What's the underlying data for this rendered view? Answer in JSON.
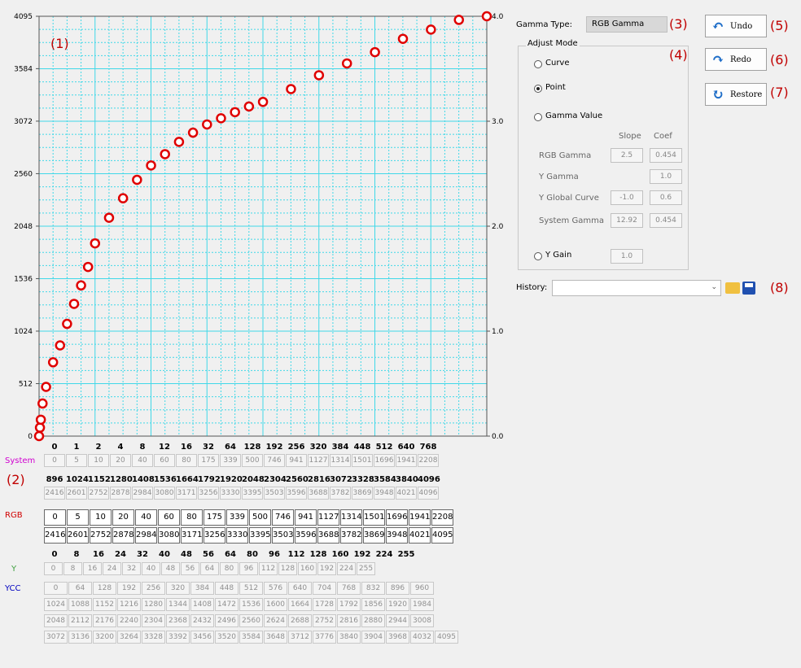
{
  "chart_data": {
    "type": "scatter",
    "y_axis_left": {
      "ticks": [
        "4095",
        "3584",
        "3072",
        "2560",
        "2048",
        "1536",
        "1024",
        "512",
        "0"
      ],
      "range": [
        0,
        4095
      ]
    },
    "y_axis_right": {
      "ticks": [
        "4.0",
        "3.0",
        "2.0",
        "1.0",
        "0.0"
      ],
      "range": [
        0,
        4
      ]
    },
    "x_range": [
      0,
      4095
    ],
    "points": [
      {
        "x": 0,
        "y": 0
      },
      {
        "x": 8,
        "y": 83
      },
      {
        "x": 16,
        "y": 160
      },
      {
        "x": 32,
        "y": 318
      },
      {
        "x": 64,
        "y": 480
      },
      {
        "x": 128,
        "y": 720
      },
      {
        "x": 192,
        "y": 885
      },
      {
        "x": 256,
        "y": 1095
      },
      {
        "x": 320,
        "y": 1290
      },
      {
        "x": 384,
        "y": 1470
      },
      {
        "x": 448,
        "y": 1650
      },
      {
        "x": 512,
        "y": 1880
      },
      {
        "x": 640,
        "y": 2130
      },
      {
        "x": 768,
        "y": 2320
      },
      {
        "x": 896,
        "y": 2500
      },
      {
        "x": 1024,
        "y": 2640
      },
      {
        "x": 1152,
        "y": 2750
      },
      {
        "x": 1280,
        "y": 2870
      },
      {
        "x": 1408,
        "y": 2960
      },
      {
        "x": 1536,
        "y": 3040
      },
      {
        "x": 1664,
        "y": 3100
      },
      {
        "x": 1792,
        "y": 3160
      },
      {
        "x": 1920,
        "y": 3215
      },
      {
        "x": 2048,
        "y": 3260
      },
      {
        "x": 2304,
        "y": 3385
      },
      {
        "x": 2560,
        "y": 3520
      },
      {
        "x": 2816,
        "y": 3635
      },
      {
        "x": 3072,
        "y": 3745
      },
      {
        "x": 3328,
        "y": 3875
      },
      {
        "x": 3584,
        "y": 3965
      },
      {
        "x": 3840,
        "y": 4060
      },
      {
        "x": 4095,
        "y": 4095
      }
    ]
  },
  "annotations": [
    "(1)",
    "(2)",
    "(3)",
    "(4)",
    "(5)",
    "(6)",
    "(7)",
    "(8)"
  ],
  "gamma_type": {
    "label": "Gamma Type:",
    "value": "RGB Gamma"
  },
  "adjust_mode": {
    "title": "Adjust Mode",
    "options": [
      "Curve",
      "Point",
      "Gamma Value",
      "Y Gain"
    ],
    "selected": "Point",
    "col_slope": "Slope",
    "col_coef": "Coef",
    "rows": [
      {
        "label": "RGB Gamma",
        "slope": "2.5",
        "coef": "0.454"
      },
      {
        "label": "Y Gamma",
        "slope": "",
        "coef": "1.0"
      },
      {
        "label": "Y Global Curve",
        "slope": "-1.0",
        "coef": "0.6"
      },
      {
        "label": "System Gamma",
        "slope": "12.92",
        "coef": "0.454"
      }
    ],
    "y_gain": "1.0"
  },
  "buttons": {
    "undo": "Undo",
    "redo": "Redo",
    "restore": "Restore"
  },
  "history": {
    "label": "History:",
    "value": ""
  },
  "tables": {
    "system_label": "System",
    "system_h1": [
      "0",
      "1",
      "2",
      "4",
      "8",
      "12",
      "16",
      "32",
      "64",
      "128",
      "192",
      "256",
      "320",
      "384",
      "448",
      "512",
      "640",
      "768"
    ],
    "system_v1": [
      "0",
      "5",
      "10",
      "20",
      "40",
      "60",
      "80",
      "175",
      "339",
      "500",
      "746",
      "941",
      "1127",
      "1314",
      "1501",
      "1696",
      "1941",
      "2208"
    ],
    "system_h2": [
      "896",
      "1024",
      "1152",
      "1280",
      "1408",
      "1536",
      "1664",
      "1792",
      "1920",
      "2048",
      "2304",
      "2560",
      "2816",
      "3072",
      "3328",
      "3584",
      "3840",
      "4096"
    ],
    "system_v2": [
      "2416",
      "2601",
      "2752",
      "2878",
      "2984",
      "3080",
      "3171",
      "3256",
      "3330",
      "3395",
      "3503",
      "3596",
      "3688",
      "3782",
      "3869",
      "3948",
      "4021",
      "4096"
    ],
    "rgb_label": "RGB",
    "rgb_v1": [
      "0",
      "5",
      "10",
      "20",
      "40",
      "60",
      "80",
      "175",
      "339",
      "500",
      "746",
      "941",
      "1127",
      "1314",
      "1501",
      "1696",
      "1941",
      "2208"
    ],
    "rgb_v2": [
      "2416",
      "2601",
      "2752",
      "2878",
      "2984",
      "3080",
      "3171",
      "3256",
      "3330",
      "3395",
      "3503",
      "3596",
      "3688",
      "3782",
      "3869",
      "3948",
      "4021",
      "4095"
    ],
    "y_label": "Y",
    "y_h": [
      "0",
      "8",
      "16",
      "24",
      "32",
      "40",
      "48",
      "56",
      "64",
      "80",
      "96",
      "112",
      "128",
      "160",
      "192",
      "224",
      "255"
    ],
    "y_v": [
      "0",
      "8",
      "16",
      "24",
      "32",
      "40",
      "48",
      "56",
      "64",
      "80",
      "96",
      "112",
      "128",
      "160",
      "192",
      "224",
      "255"
    ],
    "ycc_label": "YCC",
    "ycc_rows": [
      [
        "0",
        "64",
        "128",
        "192",
        "256",
        "320",
        "384",
        "448",
        "512",
        "576",
        "640",
        "704",
        "768",
        "832",
        "896",
        "960"
      ],
      [
        "1024",
        "1088",
        "1152",
        "1216",
        "1280",
        "1344",
        "1408",
        "1472",
        "1536",
        "1600",
        "1664",
        "1728",
        "1792",
        "1856",
        "1920",
        "1984"
      ],
      [
        "2048",
        "2112",
        "2176",
        "2240",
        "2304",
        "2368",
        "2432",
        "2496",
        "2560",
        "2624",
        "2688",
        "2752",
        "2816",
        "2880",
        "2944",
        "3008"
      ],
      [
        "3072",
        "3136",
        "3200",
        "3264",
        "3328",
        "3392",
        "3456",
        "3520",
        "3584",
        "3648",
        "3712",
        "3776",
        "3840",
        "3904",
        "3968",
        "4032",
        "4095"
      ]
    ]
  },
  "colors": {
    "point": "#e00000",
    "grid": "#40d8e8",
    "system": "#d000d0",
    "rgb": "#d00000",
    "y": "#40a040",
    "ycc": "#0000c0",
    "annotation": "#c00000"
  }
}
